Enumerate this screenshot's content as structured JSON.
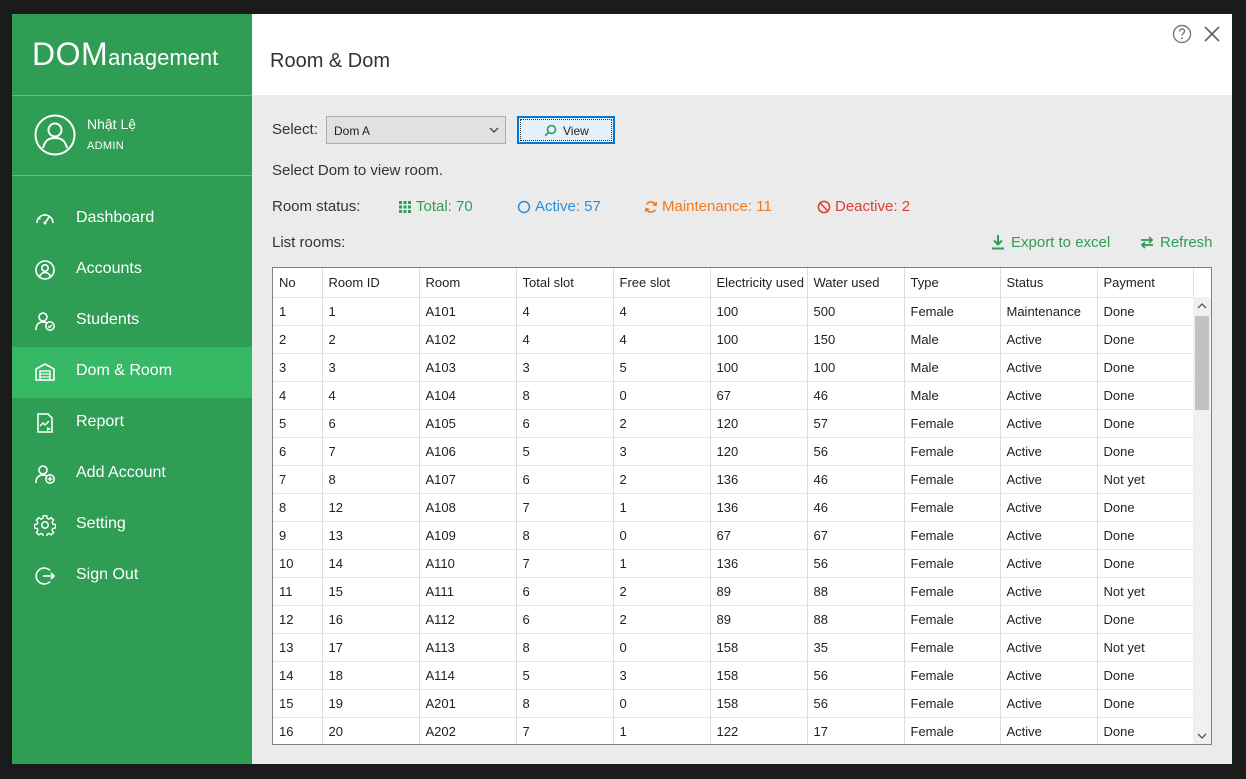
{
  "app": {
    "brand_big": "DOM",
    "brand_small": "anagement"
  },
  "user": {
    "name": "Nhật Lệ",
    "role": "ADMIN"
  },
  "nav": [
    {
      "label": "Dashboard",
      "icon": "dashboard-icon"
    },
    {
      "label": "Accounts",
      "icon": "account-icon"
    },
    {
      "label": "Students",
      "icon": "students-icon"
    },
    {
      "label": "Dom & Room",
      "icon": "dom-room-icon",
      "active": true
    },
    {
      "label": "Report",
      "icon": "report-icon"
    },
    {
      "label": "Add Account",
      "icon": "add-account-icon"
    },
    {
      "label": "Setting",
      "icon": "gear-icon"
    },
    {
      "label": "Sign Out",
      "icon": "sign-out-icon"
    }
  ],
  "page": {
    "title": "Room & Dom",
    "select_label": "Select:",
    "select_value": "Dom A",
    "view_button": "View",
    "hint": "Select Dom to view room.",
    "status_label": "Room status:",
    "list_label": "List rooms:"
  },
  "status": {
    "total": "Total: 70",
    "active": "Active: 57",
    "maintenance": "Maintenance: 11",
    "deactive": "Deactive: 2"
  },
  "actions": {
    "export": "Export to excel",
    "refresh": "Refresh"
  },
  "colors": {
    "sidebar": "#2f9e54",
    "sidebar_active": "#37b865",
    "total": "#2f9e54",
    "active": "#2b8fd6",
    "maintenance": "#f07a21",
    "deactive": "#e03c31"
  },
  "table": {
    "columns": [
      "No",
      "Room ID",
      "Room",
      "Total slot",
      "Free slot",
      "Electricity used",
      "Water used",
      "Type",
      "Status",
      "Payment"
    ],
    "rows": [
      [
        "1",
        "1",
        "A101",
        "4",
        "4",
        "100",
        "500",
        "Female",
        "Maintenance",
        "Done"
      ],
      [
        "2",
        "2",
        "A102",
        "4",
        "4",
        "100",
        "150",
        "Male",
        "Active",
        "Done"
      ],
      [
        "3",
        "3",
        "A103",
        "3",
        "5",
        "100",
        "100",
        "Male",
        "Active",
        "Done"
      ],
      [
        "4",
        "4",
        "A104",
        "8",
        "0",
        "67",
        "46",
        "Male",
        "Active",
        "Done"
      ],
      [
        "5",
        "6",
        "A105",
        "6",
        "2",
        "120",
        "57",
        "Female",
        "Active",
        "Done"
      ],
      [
        "6",
        "7",
        "A106",
        "5",
        "3",
        "120",
        "56",
        "Female",
        "Active",
        "Done"
      ],
      [
        "7",
        "8",
        "A107",
        "6",
        "2",
        "136",
        "46",
        "Female",
        "Active",
        "Not yet"
      ],
      [
        "8",
        "12",
        "A108",
        "7",
        "1",
        "136",
        "46",
        "Female",
        "Active",
        "Done"
      ],
      [
        "9",
        "13",
        "A109",
        "8",
        "0",
        "67",
        "67",
        "Female",
        "Active",
        "Done"
      ],
      [
        "10",
        "14",
        "A110",
        "7",
        "1",
        "136",
        "56",
        "Female",
        "Active",
        "Done"
      ],
      [
        "11",
        "15",
        "A111",
        "6",
        "2",
        "89",
        "88",
        "Female",
        "Active",
        "Not yet"
      ],
      [
        "12",
        "16",
        "A112",
        "6",
        "2",
        "89",
        "88",
        "Female",
        "Active",
        "Done"
      ],
      [
        "13",
        "17",
        "A113",
        "8",
        "0",
        "158",
        "35",
        "Female",
        "Active",
        "Not yet"
      ],
      [
        "14",
        "18",
        "A114",
        "5",
        "3",
        "158",
        "56",
        "Female",
        "Active",
        "Done"
      ],
      [
        "15",
        "19",
        "A201",
        "8",
        "0",
        "158",
        "56",
        "Female",
        "Active",
        "Done"
      ],
      [
        "16",
        "20",
        "A202",
        "7",
        "1",
        "122",
        "17",
        "Female",
        "Active",
        "Done"
      ]
    ]
  }
}
